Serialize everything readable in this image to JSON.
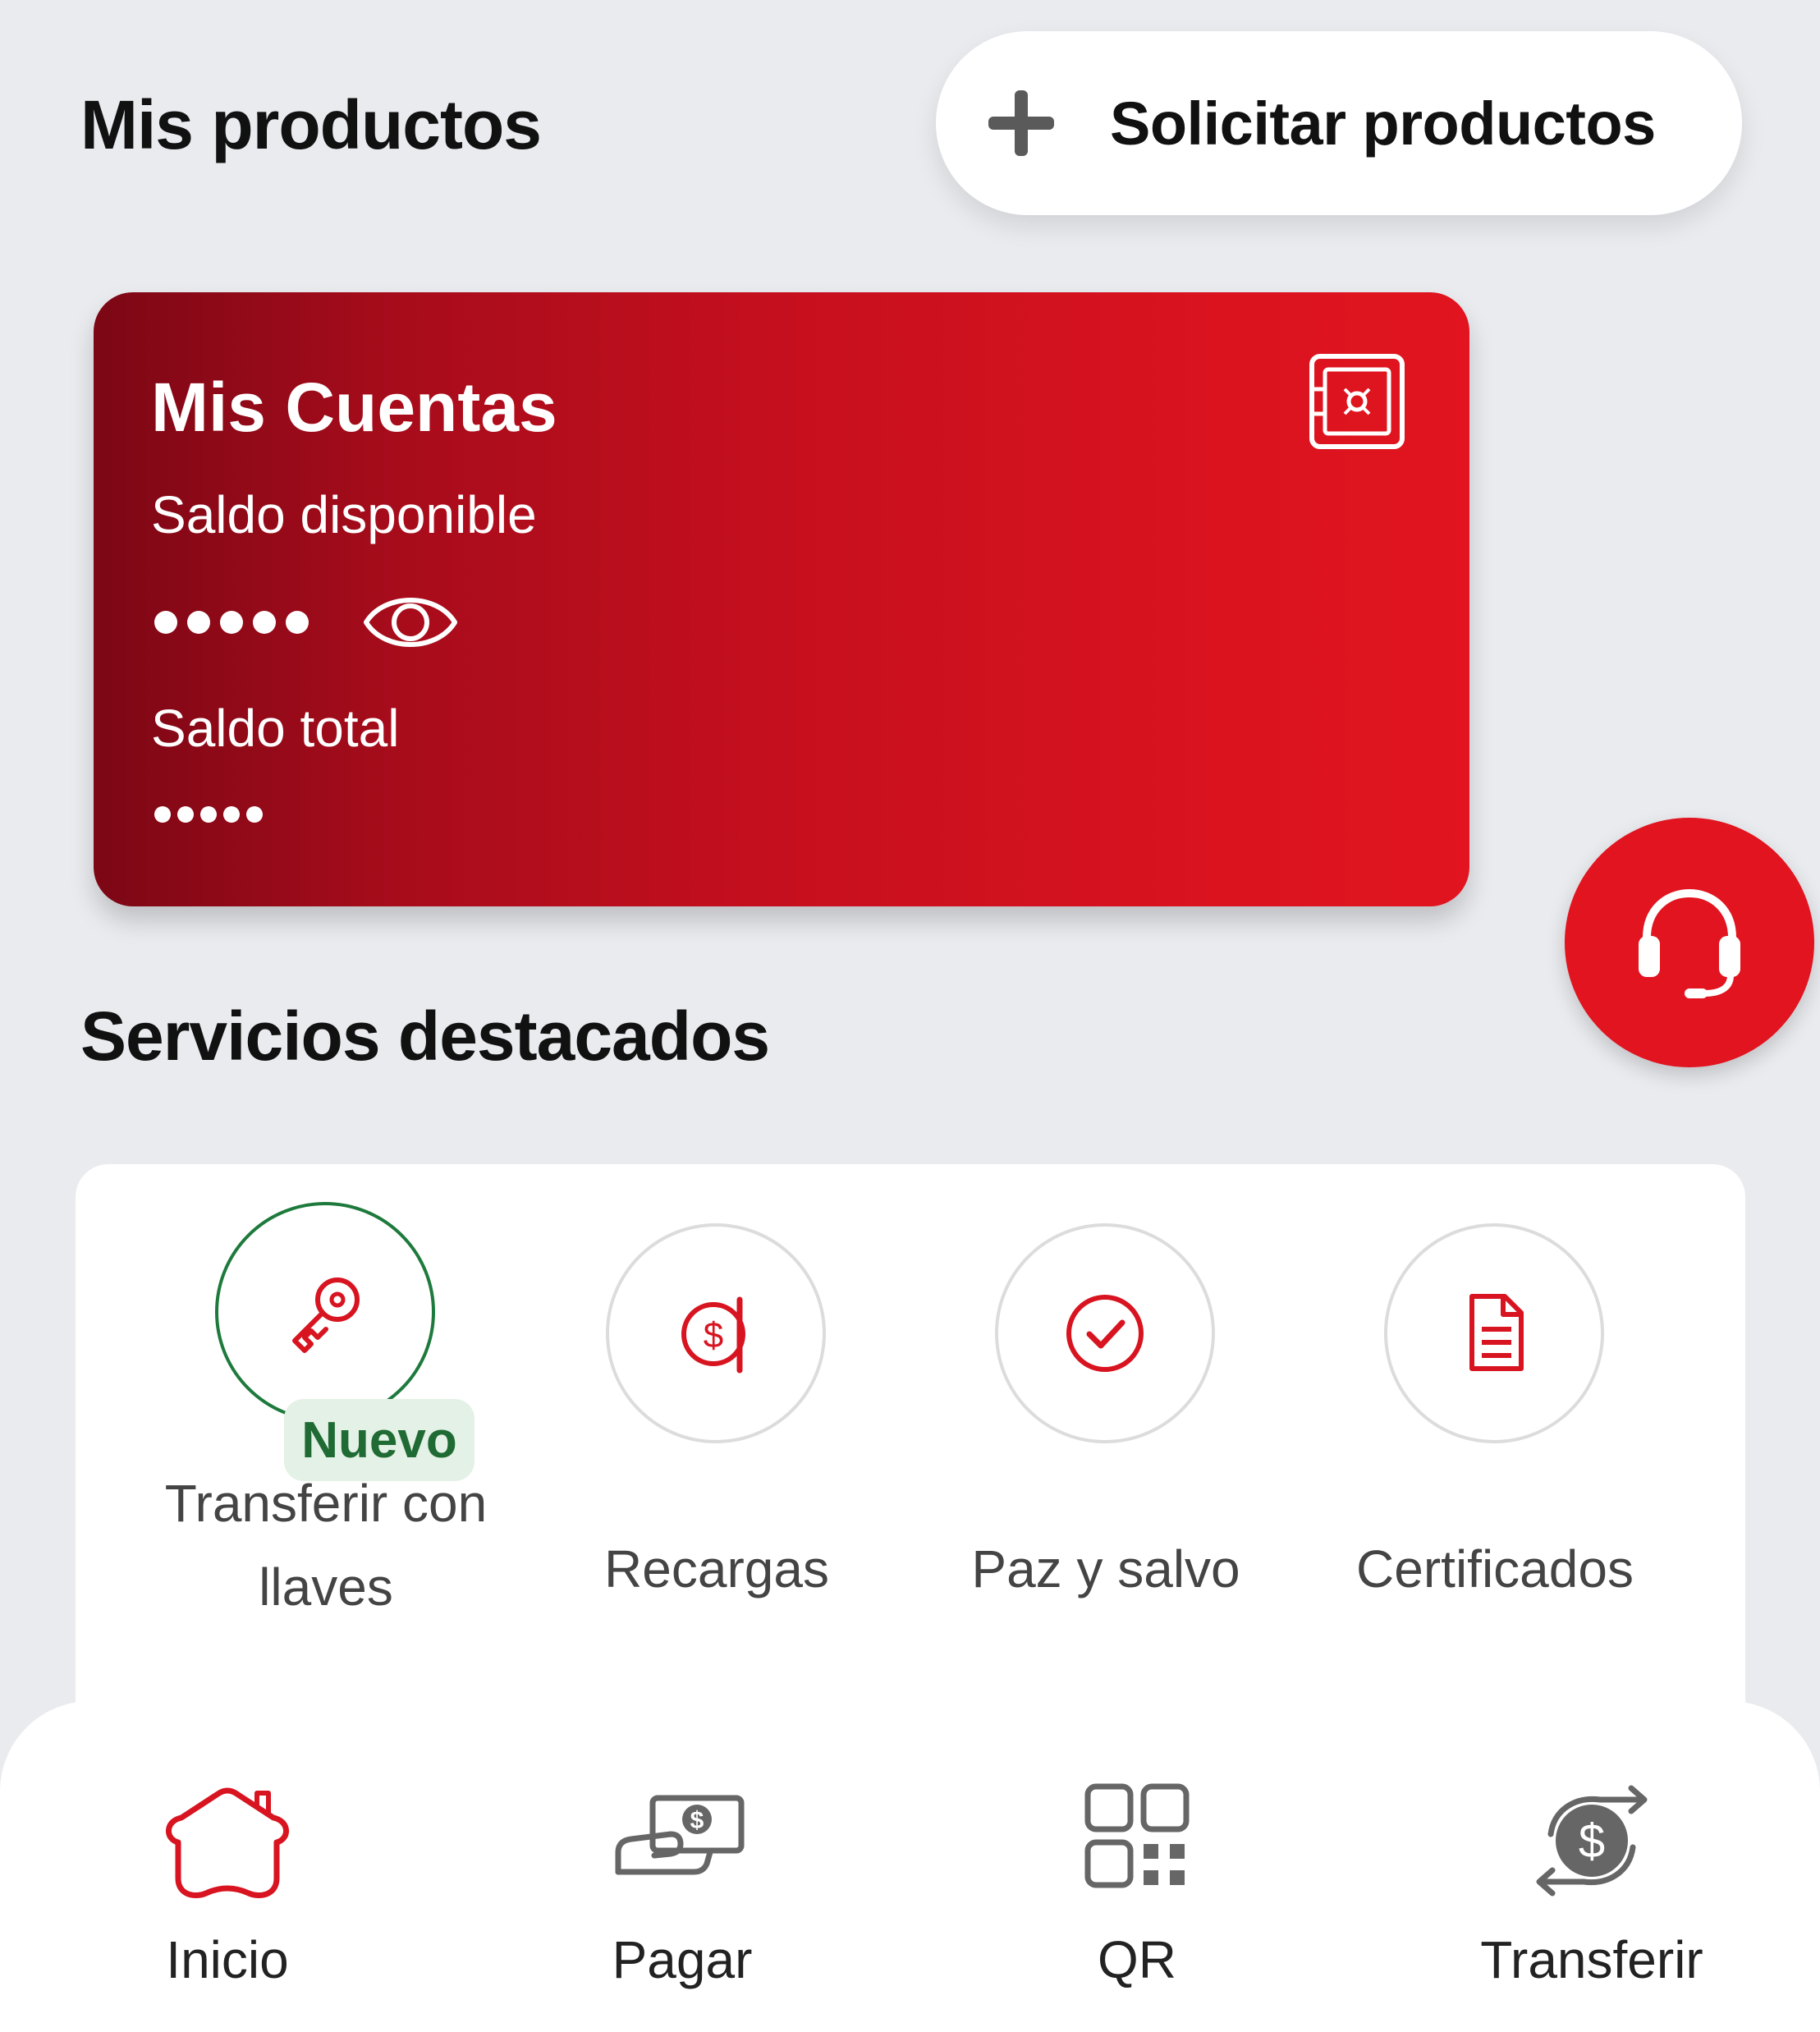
{
  "header": {
    "title": "Mis productos",
    "request_button_label": "Solicitar productos"
  },
  "accounts_card": {
    "title": "Mis Cuentas",
    "available_label": "Saldo disponible",
    "available_value": "•••••",
    "total_label": "Saldo total",
    "total_value": "•••••"
  },
  "services": {
    "title": "Servicios destacados",
    "items": [
      {
        "label": "Transferir con llaves",
        "icon": "key-icon",
        "badge": "Nuevo"
      },
      {
        "label": "Recargas",
        "icon": "recharge-icon"
      },
      {
        "label": "Paz y salvo",
        "icon": "check-circle-icon"
      },
      {
        "label": "Certificados",
        "icon": "document-icon"
      }
    ]
  },
  "support": {
    "icon": "headset-icon"
  },
  "bottom_nav": {
    "items": [
      {
        "label": "Inicio",
        "icon": "home-icon",
        "active": true
      },
      {
        "label": "Pagar",
        "icon": "pay-icon"
      },
      {
        "label": "QR",
        "icon": "qr-icon"
      },
      {
        "label": "Transferir",
        "icon": "transfer-icon"
      }
    ]
  },
  "colors": {
    "brand_red": "#e1141f",
    "brand_dark_red": "#7c0715",
    "new_green": "#1f6b33",
    "background": "#eaebef"
  }
}
